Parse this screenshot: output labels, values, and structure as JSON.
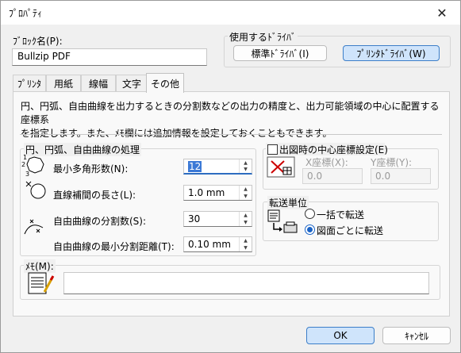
{
  "window": {
    "title": "ﾌﾟﾛﾊﾟﾃｨ",
    "close_glyph": "✕"
  },
  "block_name": {
    "label": "ﾌﾞﾛｯｸ名(P):",
    "value": "Bullzip PDF"
  },
  "driver_group": {
    "title": "使用するﾄﾞﾗｲﾊﾞ",
    "standard_label": "標準ﾄﾞﾗｲﾊﾞ(I)",
    "printer_label": "ﾌﾟﾘﾝﾀﾄﾞﾗｲﾊﾞ(W)"
  },
  "tabs": [
    {
      "label": "ﾌﾟﾘﾝﾀ",
      "active": false
    },
    {
      "label": "用紙",
      "active": false
    },
    {
      "label": "線幅",
      "active": false
    },
    {
      "label": "文字",
      "active": false
    },
    {
      "label": "その他",
      "active": true
    }
  ],
  "description": {
    "line1": "円、円弧、自由曲線を出力するときの分割数などの出力の精度と、出力可能領域の中心に配置する座標系",
    "line2": "を指定します。また、ﾒﾓ欄には追加情報を設定しておくこともできます。"
  },
  "curve_group": {
    "title": "円、円弧、自由曲線の処理",
    "polygon": {
      "label": "最小多角形数(N):",
      "value": "12"
    },
    "line_interp": {
      "label": "直線補間の長さ(L):",
      "value": "1.0 mm"
    },
    "free_div": {
      "label": "自由曲線の分割数(S):",
      "value": "30"
    },
    "free_min": {
      "label": "自由曲線の最小分割距離(T):",
      "value": "0.10 mm"
    },
    "icon_digits": [
      "1",
      "2",
      "3"
    ]
  },
  "center_group": {
    "title": "出図時の中心座標設定(E)",
    "checked": false,
    "x_label": "X座標(X):",
    "x_value": "0.0",
    "y_label": "Y座標(Y):",
    "y_value": "0.0"
  },
  "transfer_group": {
    "title": "転送単位",
    "option_all": "一括で転送",
    "option_each": "図面ごとに転送",
    "selected": "each"
  },
  "memo": {
    "label": "ﾒﾓ(M):",
    "value": ""
  },
  "buttons": {
    "ok": "OK",
    "cancel": "ｷｬﾝｾﾙ"
  },
  "colors": {
    "accent": "#3b79d6",
    "primary_button_bg": "#cfe4fb",
    "dialog_bg": "#f0f0f0"
  }
}
